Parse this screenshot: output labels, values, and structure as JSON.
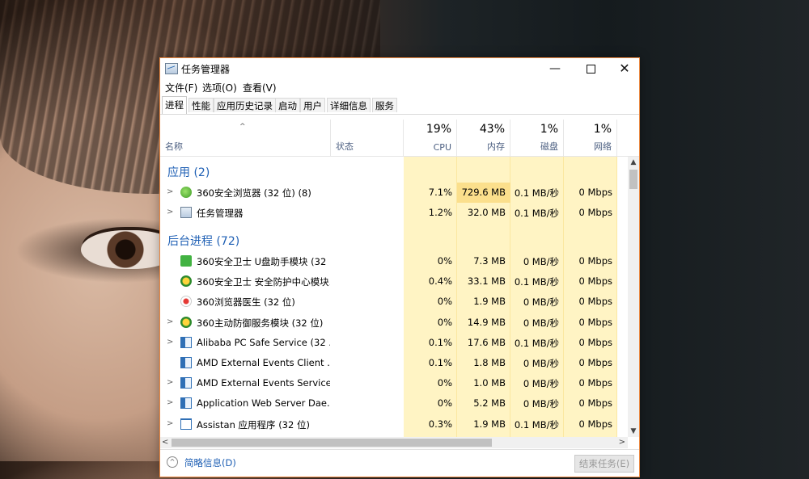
{
  "window": {
    "title": "任务管理器"
  },
  "controls": {
    "minimize": "—",
    "close": "✕"
  },
  "menu": [
    "文件(F)",
    "选项(O)",
    "查看(V)"
  ],
  "tabs": [
    "进程",
    "性能",
    "应用历史记录",
    "启动",
    "用户",
    "详细信息",
    "服务"
  ],
  "header": {
    "sort_arrow": "^",
    "name": "名称",
    "status": "状态",
    "cpu": {
      "pct": "19%",
      "label": "CPU"
    },
    "memory": {
      "pct": "43%",
      "label": "内存"
    },
    "disk": {
      "pct": "1%",
      "label": "磁盘"
    },
    "network": {
      "pct": "1%",
      "label": "网络"
    }
  },
  "groups": {
    "apps": "应用 (2)",
    "background": "后台进程 (72)"
  },
  "apps": [
    {
      "chevron": ">",
      "icon": "browser-360-icon",
      "name": "360安全浏览器 (32 位) (8)",
      "cpu": "7.1%",
      "mem": "729.6 MB",
      "disk": "0.1 MB/秒",
      "net": "0 Mbps"
    },
    {
      "chevron": ">",
      "icon": "task-manager-icon",
      "name": "任务管理器",
      "cpu": "1.2%",
      "mem": "32.0 MB",
      "disk": "0.1 MB/秒",
      "net": "0 Mbps"
    }
  ],
  "background": [
    {
      "chevron": "",
      "icon": "guard-icon",
      "name": "360安全卫士 U盘助手模块 (32 ...",
      "cpu": "0%",
      "mem": "7.3 MB",
      "disk": "0 MB/秒",
      "net": "0 Mbps"
    },
    {
      "chevron": "",
      "icon": "shield-icon",
      "name": "360安全卫士 安全防护中心模块...",
      "cpu": "0.4%",
      "mem": "33.1 MB",
      "disk": "0.1 MB/秒",
      "net": "0 Mbps"
    },
    {
      "chevron": "",
      "icon": "doctor-icon",
      "name": "360浏览器医生 (32 位)",
      "cpu": "0%",
      "mem": "1.9 MB",
      "disk": "0 MB/秒",
      "net": "0 Mbps"
    },
    {
      "chevron": ">",
      "icon": "shield-icon",
      "name": "360主动防御服务模块 (32 位)",
      "cpu": "0%",
      "mem": "14.9 MB",
      "disk": "0 MB/秒",
      "net": "0 Mbps"
    },
    {
      "chevron": ">",
      "icon": "service-box-icon",
      "name": "Alibaba PC Safe Service (32 ...",
      "cpu": "0.1%",
      "mem": "17.6 MB",
      "disk": "0.1 MB/秒",
      "net": "0 Mbps"
    },
    {
      "chevron": "",
      "icon": "service-box-icon",
      "name": "AMD External Events Client ...",
      "cpu": "0.1%",
      "mem": "1.8 MB",
      "disk": "0 MB/秒",
      "net": "0 Mbps"
    },
    {
      "chevron": ">",
      "icon": "service-box-icon",
      "name": "AMD External Events Service ...",
      "cpu": "0%",
      "mem": "1.0 MB",
      "disk": "0 MB/秒",
      "net": "0 Mbps"
    },
    {
      "chevron": ">",
      "icon": "service-box-icon",
      "name": "Application Web Server Dae...",
      "cpu": "0%",
      "mem": "5.2 MB",
      "disk": "0 MB/秒",
      "net": "0 Mbps"
    },
    {
      "chevron": ">",
      "icon": "window-icon",
      "name": "Assistan 应用程序 (32 位)",
      "cpu": "0.3%",
      "mem": "1.9 MB",
      "disk": "0.1 MB/秒",
      "net": "0 Mbps"
    }
  ],
  "footer": {
    "fewer_details": "简略信息(D)",
    "end_task": "结束任务(E)"
  },
  "colors": {
    "accent_border": "#e8863f",
    "group_blue": "#1e5fb4",
    "heat_light": "#fff4c4",
    "heat_mem": "#fbdf8c"
  }
}
